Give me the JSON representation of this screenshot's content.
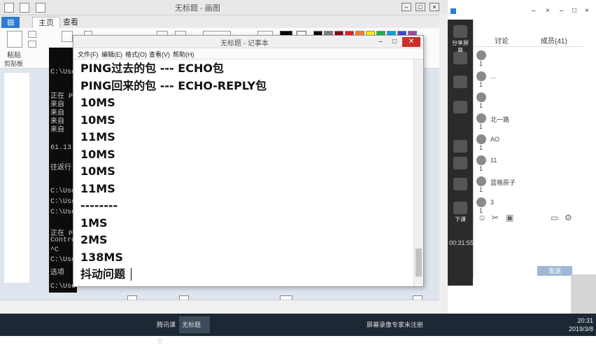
{
  "paint": {
    "title": "无标题 - 画图",
    "tabs": [
      "主页",
      "查看"
    ],
    "ribbon": {
      "paste_label": "粘贴",
      "clipboard_label": "剪贴板"
    },
    "colors": [
      "#000000",
      "#7f7f7f",
      "#880015",
      "#ed1c24",
      "#ff7f27",
      "#fff200",
      "#22b14c",
      "#00a2e8",
      "#3f48cc",
      "#a349a4"
    ]
  },
  "console": {
    "lines": [
      "C:\\Use",
      "正在 P",
      "来自",
      "来自",
      "来自",
      "来自",
      "61.13",
      "往返行",
      "C:\\Use",
      "C:\\Use",
      "C:\\Use",
      "正在 P",
      "Contro",
      "^C",
      "C:\\Use",
      "选项",
      "C:\\Use"
    ]
  },
  "notepad": {
    "title": "无标题 - 记事本",
    "menu": [
      "文件(F)",
      "编辑(E)",
      "格式(O)",
      "查看(V)",
      "帮助(H)"
    ],
    "lines": [
      "PING过去的包 --- ECHO包",
      "PING回来的包 --- ECHO-REPLY包",
      "10MS",
      "10MS",
      "11MS",
      "10MS",
      "10MS",
      "11MS",
      "--------",
      "1MS",
      "2MS",
      "138MS",
      "抖动问题"
    ]
  },
  "qq": {
    "sidebar": [
      {
        "label": "分享屏幕"
      },
      {
        "label": ""
      },
      {
        "label": ""
      },
      {
        "label": ""
      },
      {
        "label": ""
      },
      {
        "label": ""
      },
      {
        "label": ""
      },
      {
        "label": "下课"
      }
    ],
    "elapsed": "00:31:55",
    "tabs": [
      "讨论",
      "成员(41)"
    ],
    "members": [
      {
        "name": "",
        "num": "1"
      },
      {
        "name": "...",
        "num": "1"
      },
      {
        "name": "",
        "num": "1"
      },
      {
        "name": "北一路",
        "num": "1"
      },
      {
        "name": "AO",
        "num": "1"
      },
      {
        "name": "11",
        "num": "1"
      },
      {
        "name": "蓝格原子",
        "num": "1"
      },
      {
        "name": "3",
        "num": "1"
      }
    ],
    "send_label": "发送"
  },
  "taskbar": {
    "items": [
      "",
      "",
      "",
      "",
      "",
      "",
      "腾讯课堂",
      "无标题",
      "",
      "屏幕录像专家未注册"
    ],
    "time": "20:31",
    "date": "2019/3/8"
  }
}
